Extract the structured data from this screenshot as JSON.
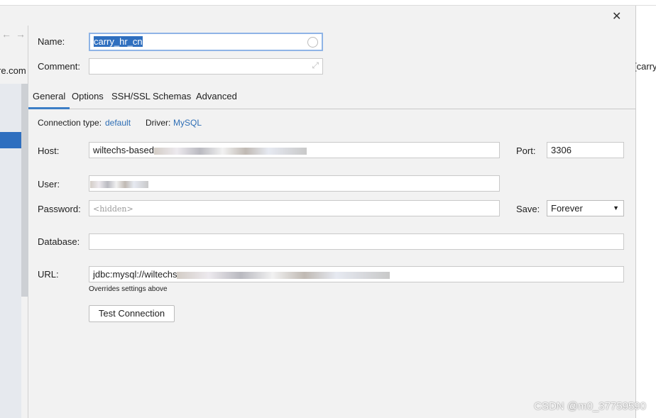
{
  "background": {
    "left_text": "re.com",
    "right_text": "[carry"
  },
  "name": {
    "label": "Name:",
    "value": "carry_hr_cn"
  },
  "comment": {
    "label": "Comment:",
    "value": ""
  },
  "tabs": [
    {
      "label": "General",
      "active": true
    },
    {
      "label": "Options"
    },
    {
      "label": "SSH/SSL"
    },
    {
      "label": "Schemas"
    },
    {
      "label": "Advanced"
    }
  ],
  "connection": {
    "type_label": "Connection type:",
    "type_value": "default",
    "driver_label": "Driver:",
    "driver_value": "MySQL"
  },
  "host": {
    "label": "Host:",
    "value_visible": "wiltechs-based"
  },
  "port": {
    "label": "Port:",
    "value": "3306"
  },
  "user": {
    "label": "User:"
  },
  "password": {
    "label": "Password:",
    "placeholder": "<hidden>"
  },
  "save": {
    "label": "Save:",
    "value": "Forever"
  },
  "database": {
    "label": "Database:",
    "value": ""
  },
  "url": {
    "label": "URL:",
    "value_visible": "jdbc:mysql://wiltechs",
    "hint": "Overrides settings above"
  },
  "test_button": "Test Connection",
  "watermark": "CSDN @m0_37759590",
  "colors": {
    "accent": "#3c7ec6",
    "selection": "#2f6fbf",
    "link": "#2e6eb5"
  }
}
